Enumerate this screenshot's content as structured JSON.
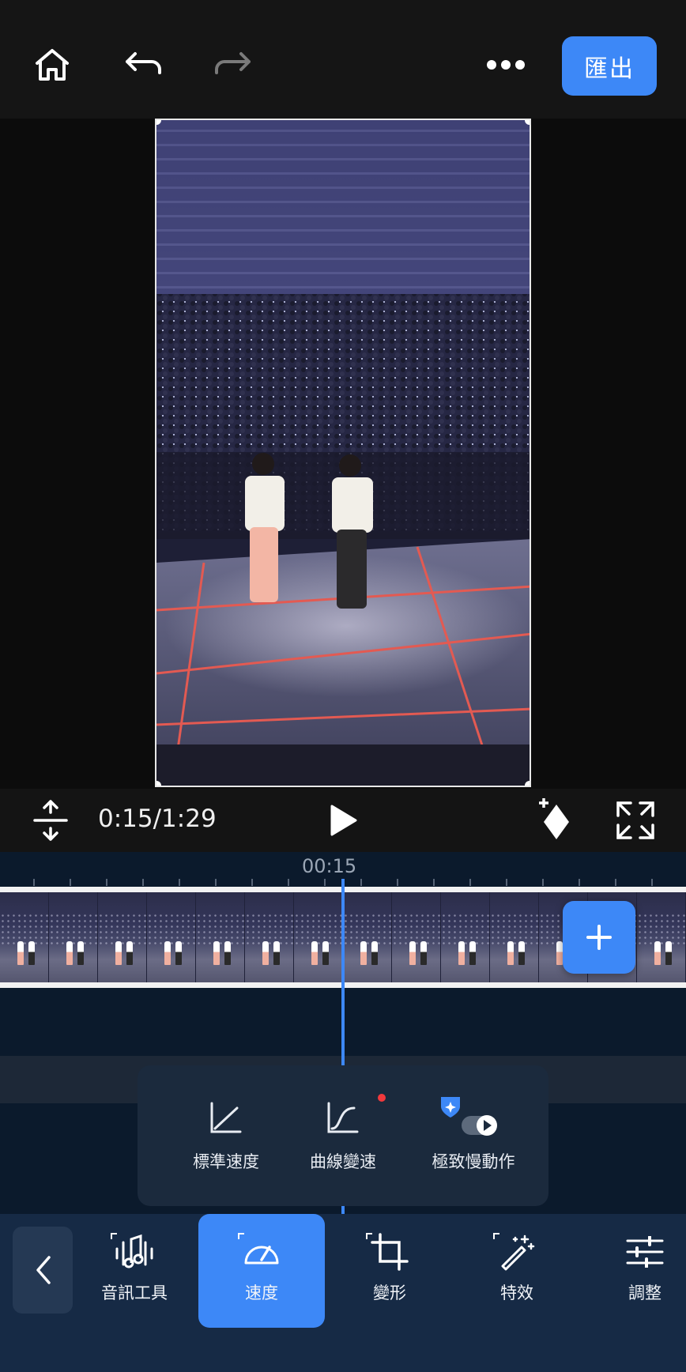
{
  "topbar": {
    "home_icon": "home-icon",
    "undo_icon": "undo-icon",
    "redo_icon": "redo-icon",
    "more_icon": "more-icon",
    "export_label": "匯出"
  },
  "playback": {
    "time_display": "0:15/1:29",
    "split_icon": "split-vertical-icon",
    "play_icon": "play-icon",
    "keyframe_icon": "add-keyframe-icon",
    "fullscreen_icon": "fullscreen-icon"
  },
  "timeline": {
    "ruler_time": "00:15",
    "add_clip_icon": "plus-icon"
  },
  "speed_menu": {
    "items": [
      {
        "label": "標準速度",
        "icon": "normal-speed-icon"
      },
      {
        "label": "曲線變速",
        "icon": "curve-speed-icon",
        "badge": "new-dot"
      },
      {
        "label": "極致慢動作",
        "icon": "slow-motion-toggle-icon"
      }
    ]
  },
  "toolbar": {
    "back_icon": "chevron-left-icon",
    "items": [
      {
        "label": "音訊工具",
        "icon": "audio-tools-icon"
      },
      {
        "label": "速度",
        "icon": "speedometer-icon",
        "active": true
      },
      {
        "label": "變形",
        "icon": "crop-icon"
      },
      {
        "label": "特效",
        "icon": "magic-wand-icon"
      },
      {
        "label": "調整",
        "icon": "sliders-icon"
      }
    ]
  },
  "colors": {
    "accent": "#3d88f7",
    "toolbar_bg": "#162a45",
    "timeline_bg": "#0b1a2c",
    "badge_red": "#f2393c"
  }
}
